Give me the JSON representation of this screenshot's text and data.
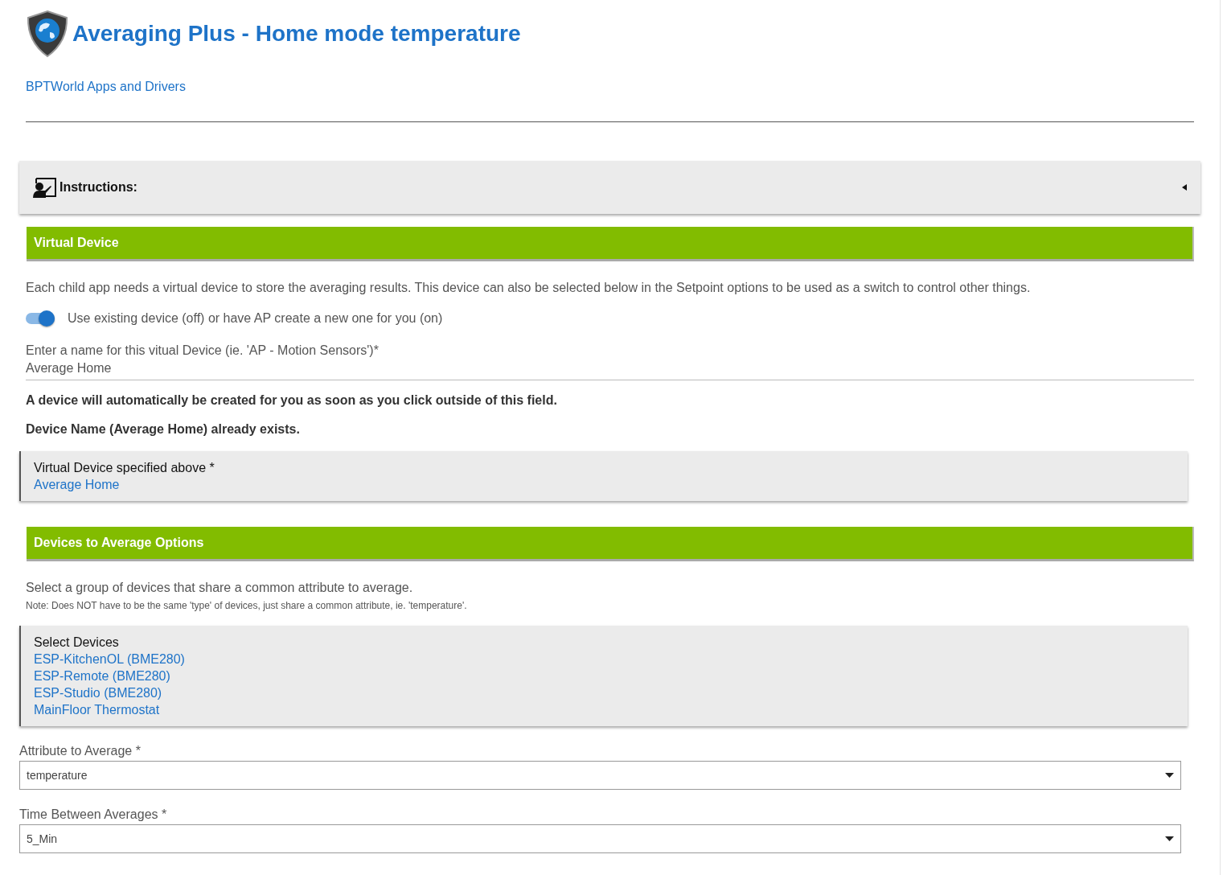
{
  "header": {
    "title": "Averaging Plus - Home mode temperature",
    "link": "BPTWorld Apps and Drivers"
  },
  "instructions": {
    "label": "Instructions:",
    "expanded": false
  },
  "virtual_device": {
    "heading": "Virtual Device",
    "description": "Each child app needs a virtual device to store the averaging results. This device can also be selected below in the Setpoint options to be used as a switch to control other things.",
    "toggle": {
      "label": "Use existing device (off) or have AP create a new one for you (on)",
      "on": true
    },
    "name_field": {
      "label": "Enter a name for this vitual Device (ie. 'AP - Motion Sensors')*",
      "value": "Average Home"
    },
    "notes": [
      "A device will automatically be created for you as soon as you click outside of this field.",
      "Device Name (Average Home) already exists."
    ],
    "selected_card": {
      "label": "Virtual Device specified above *",
      "items": [
        "Average Home"
      ]
    }
  },
  "devices_options": {
    "heading": "Devices to Average Options",
    "description": "Select a group of devices that share a common attribute to average.",
    "note": "Note: Does NOT have to be the same 'type' of devices, just share a common attribute, ie. 'temperature'.",
    "selected_card": {
      "label": "Select Devices",
      "items": [
        "ESP-KitchenOL (BME280)",
        "ESP-Remote (BME280)",
        "ESP-Studio (BME280)",
        "MainFloor Thermostat"
      ]
    },
    "dropdowns": [
      {
        "label": "Attribute to Average *",
        "value": "temperature"
      },
      {
        "label": "Time Between Averages *",
        "value": "5_Min"
      }
    ]
  }
}
